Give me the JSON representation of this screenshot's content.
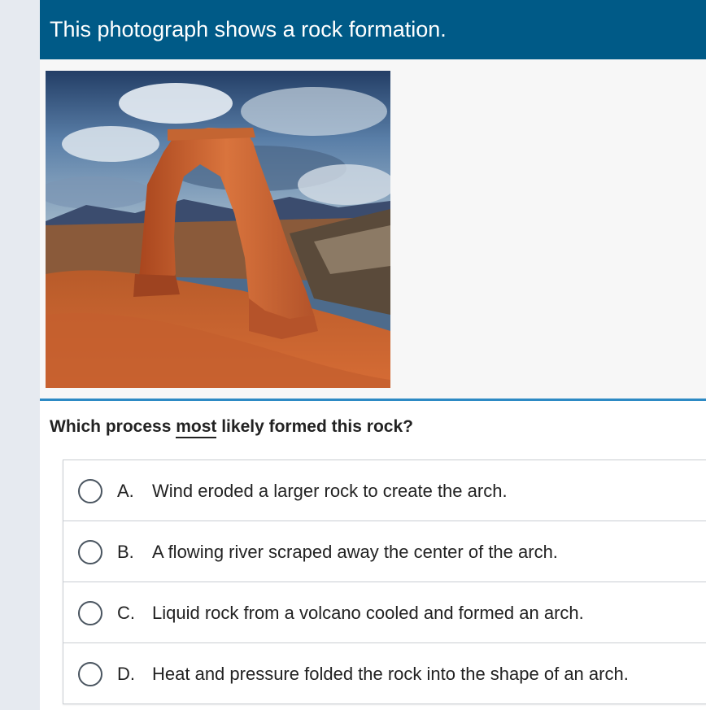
{
  "passage": {
    "header_text": "This photograph shows a rock formation.",
    "image_icon": "rock-arch-photo"
  },
  "question": {
    "prompt_before": "Which process ",
    "prompt_emphasis": "most",
    "prompt_after": " likely formed this rock?"
  },
  "options": [
    {
      "letter": "A.",
      "text": "Wind eroded a larger rock to create the arch."
    },
    {
      "letter": "B.",
      "text": "A flowing river scraped away the center of the arch."
    },
    {
      "letter": "C.",
      "text": "Liquid rock from a volcano cooled and formed an arch."
    },
    {
      "letter": "D.",
      "text": "Heat and pressure folded the rock into the shape of an arch."
    }
  ],
  "colors": {
    "header_bg": "#005a87",
    "divider": "#2d8ac4",
    "page_bg": "#e6eaf0"
  }
}
